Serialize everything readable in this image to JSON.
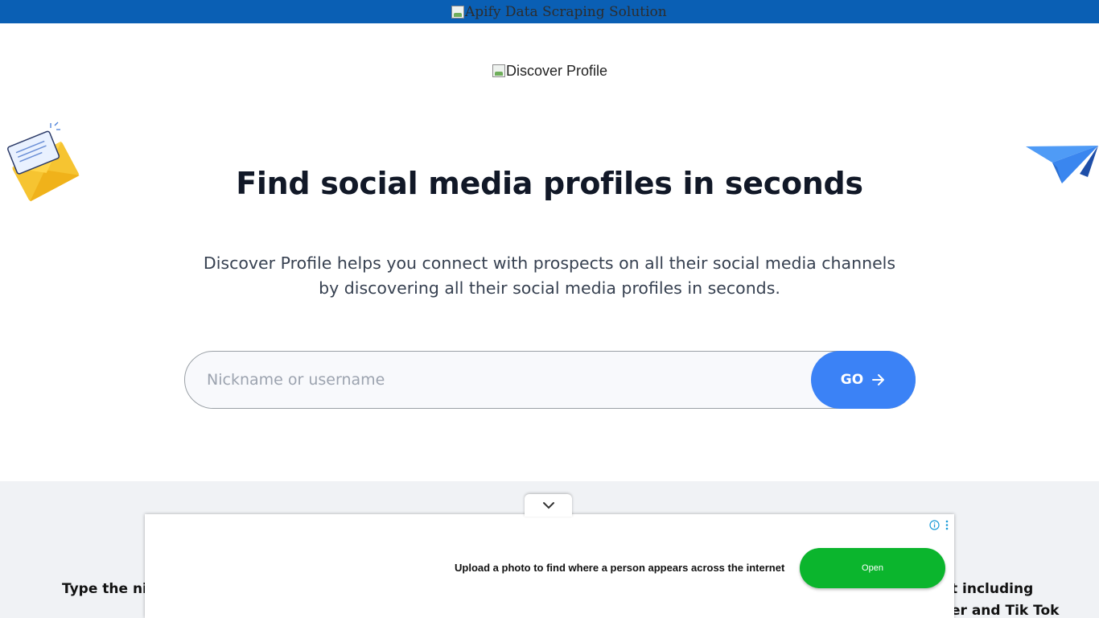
{
  "topbar": {
    "banner_alt": "Apify Data Scraping Solution",
    "color": "#0a5fb4"
  },
  "header": {
    "logo_alt": "Discover Profile"
  },
  "hero": {
    "title": "Find social media profiles in seconds",
    "description_line1": "Discover Profile helps you connect with prospects on all their social media channels",
    "description_line2": "by discovering all their social media profiles in seconds."
  },
  "search": {
    "placeholder": "Nickname or username",
    "value": "",
    "button_label": "GO",
    "button_icon": "arrow-right-icon",
    "accent": "#3b82f6"
  },
  "section": {
    "text_left": "Type the nick",
    "text_right_line1": "t including",
    "text_right_line2": "er and Tik Tok",
    "collapse_icon": "chevron-down-icon"
  },
  "ad": {
    "text": "Upload a photo to find where a person appears across the internet",
    "button_label": "Open",
    "button_color": "#0bb52d",
    "info_icon": "info-icon",
    "menu_icon": "kebab-menu-icon"
  },
  "decorations": {
    "left": "envelope-illustration",
    "right": "paper-plane-illustration"
  }
}
